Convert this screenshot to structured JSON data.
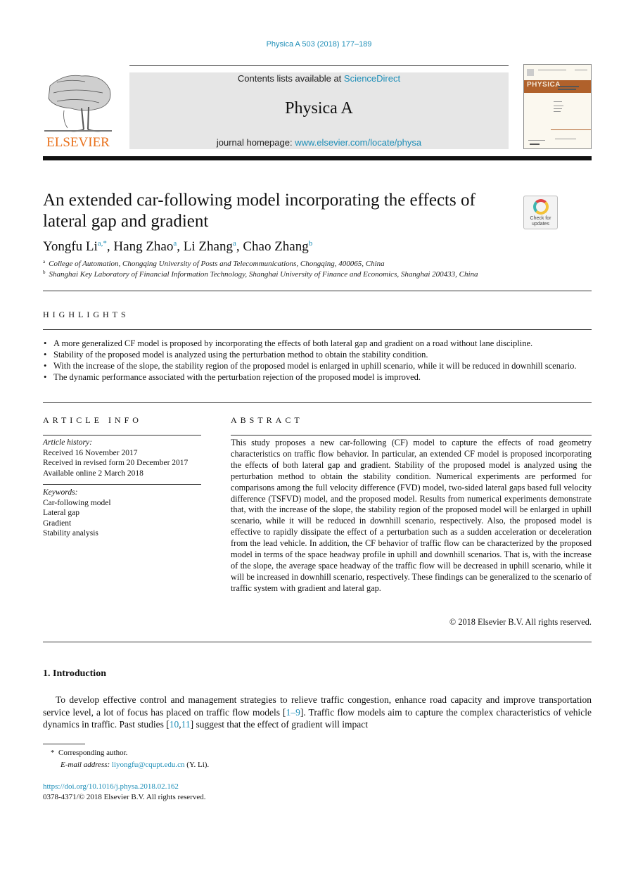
{
  "journal_ref": "Physica A 503 (2018) 177–189",
  "publisher": {
    "name": "ELSEVIER",
    "logo_icon": "elsevier-tree-logo"
  },
  "header": {
    "contents_prefix": "Contents lists available at ",
    "contents_link": "ScienceDirect",
    "journal_name": "Physica A",
    "homepage_prefix": "journal homepage: ",
    "homepage_link": "www.elsevier.com/locate/physa"
  },
  "cover": {
    "band_text": "PHYSICA",
    "icon": "journal-cover-thumbnail"
  },
  "check_updates": {
    "icon": "check-for-updates-icon",
    "line1": "Check for",
    "line2": "updates"
  },
  "article": {
    "title": "An extended car-following model incorporating the effects of lateral gap and gradient",
    "authors": [
      {
        "name": "Yongfu Li",
        "sup": "a,*"
      },
      {
        "name": "Hang Zhao",
        "sup": "a"
      },
      {
        "name": "Li Zhang",
        "sup": "a"
      },
      {
        "name": "Chao Zhang",
        "sup": "b"
      }
    ],
    "affiliations": [
      {
        "mark": "a",
        "text": "College of Automation, Chongqing University of Posts and Telecommunications, Chongqing, 400065, China"
      },
      {
        "mark": "b",
        "text": "Shanghai Key Laboratory of Financial Information Technology, Shanghai University of Finance and Economics, Shanghai 200433, China"
      }
    ]
  },
  "highlights": {
    "heading": "HIGHLIGHTS",
    "items": [
      "A more generalized CF model is proposed by incorporating the effects of both lateral gap and gradient on a road without lane discipline.",
      "Stability of the proposed model is analyzed using the perturbation method to obtain the stability condition.",
      "With the increase of the slope, the stability region of the proposed model is enlarged in uphill scenario, while it will be reduced in downhill scenario.",
      "The dynamic performance associated with the perturbation rejection of the proposed model is improved."
    ]
  },
  "article_info": {
    "heading": "ARTICLE INFO",
    "history_label": "Article history:",
    "history": [
      "Received 16 November 2017",
      "Received in revised form 20 December 2017",
      "Available online 2 March 2018"
    ],
    "keywords_label": "Keywords:",
    "keywords": [
      "Car-following model",
      "Lateral gap",
      "Gradient",
      "Stability analysis"
    ]
  },
  "abstract": {
    "heading": "ABSTRACT",
    "text": "This study proposes a new car-following (CF) model to capture the effects of road geometry characteristics on traffic flow behavior. In particular, an extended CF model is proposed incorporating the effects of both lateral gap and gradient. Stability of the proposed model is analyzed using the perturbation method to obtain the stability condition. Numerical experiments are performed for comparisons among the full velocity difference (FVD) model, two-sided lateral gaps based full velocity difference (TSFVD) model, and the proposed model. Results from numerical experiments demonstrate that, with the increase of the slope, the stability region of the proposed model will be enlarged in uphill scenario, while it will be reduced in downhill scenario, respectively. Also, the proposed model is effective to rapidly dissipate the effect of a perturbation such as a sudden acceleration or deceleration from the lead vehicle. In addition, the CF behavior of traffic flow can be characterized by the proposed model in terms of the space headway profile in uphill and downhill scenarios. That is, with the increase of the slope, the average space headway of the traffic flow will be decreased in uphill scenario, while it will be increased in downhill scenario, respectively. These findings can be generalized to the scenario of traffic system with gradient and lateral gap.",
    "copyright": "© 2018 Elsevier B.V. All rights reserved."
  },
  "introduction": {
    "heading": "1.  Introduction",
    "text_part1": "To develop effective control and management strategies to relieve traffic congestion, enhance road capacity and improve transportation service level, a lot of focus has placed on traffic flow models [",
    "ref1": "1–9",
    "text_part2": "]. Traffic flow models aim to capture the complex characteristics of vehicle dynamics in traffic. Past studies [",
    "ref2": "10",
    "ref_sep": ",",
    "ref3": "11",
    "text_part3": "] suggest that the effect of gradient will impact"
  },
  "footnotes": {
    "corresponding_mark": "*",
    "corresponding_text": "Corresponding author.",
    "email_label": "E-mail address: ",
    "email": "liyongfu@cqupt.edu.cn",
    "email_suffix": " (Y. Li)."
  },
  "doi": {
    "link": "https://doi.org/10.1016/j.physa.2018.02.162",
    "issn_line": "0378-4371/© 2018 Elsevier B.V. All rights reserved."
  }
}
